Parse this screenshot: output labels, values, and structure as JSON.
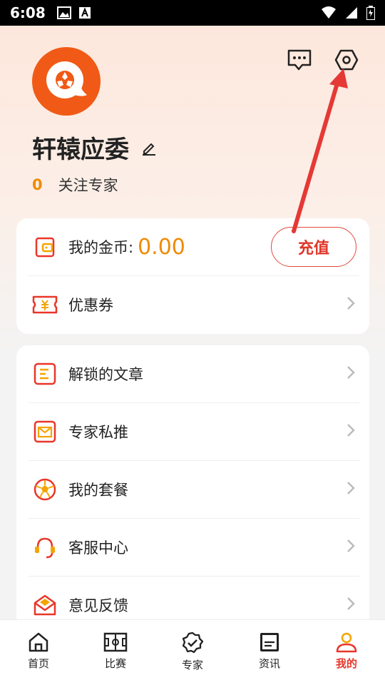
{
  "status_bar": {
    "time": "6:08"
  },
  "profile": {
    "username": "轩辕应委",
    "follow_count": "0",
    "follow_label": "关注专家"
  },
  "wallet": {
    "coins_label": "我的金币:",
    "coins_value": "0.00",
    "recharge_label": "充值",
    "coupon_label": "优惠券"
  },
  "menu": [
    {
      "label": "解锁的文章",
      "icon": "article-icon"
    },
    {
      "label": "专家私推",
      "icon": "mail-icon"
    },
    {
      "label": "我的套餐",
      "icon": "football-icon"
    },
    {
      "label": "客服中心",
      "icon": "headset-icon"
    },
    {
      "label": "意见反馈",
      "icon": "feedback-envelope-icon"
    }
  ],
  "tabbar": {
    "items": [
      {
        "label": "首页",
        "icon": "home-icon",
        "active": false
      },
      {
        "label": "比赛",
        "icon": "field-icon",
        "active": false
      },
      {
        "label": "专家",
        "icon": "verified-badge-icon",
        "active": false
      },
      {
        "label": "资讯",
        "icon": "news-icon",
        "active": false
      },
      {
        "label": "我的",
        "icon": "person-icon",
        "active": true
      }
    ]
  },
  "colors": {
    "accent_red": "#e9362a",
    "accent_orange": "#f08a00",
    "avatar_orange": "#f05a16"
  }
}
